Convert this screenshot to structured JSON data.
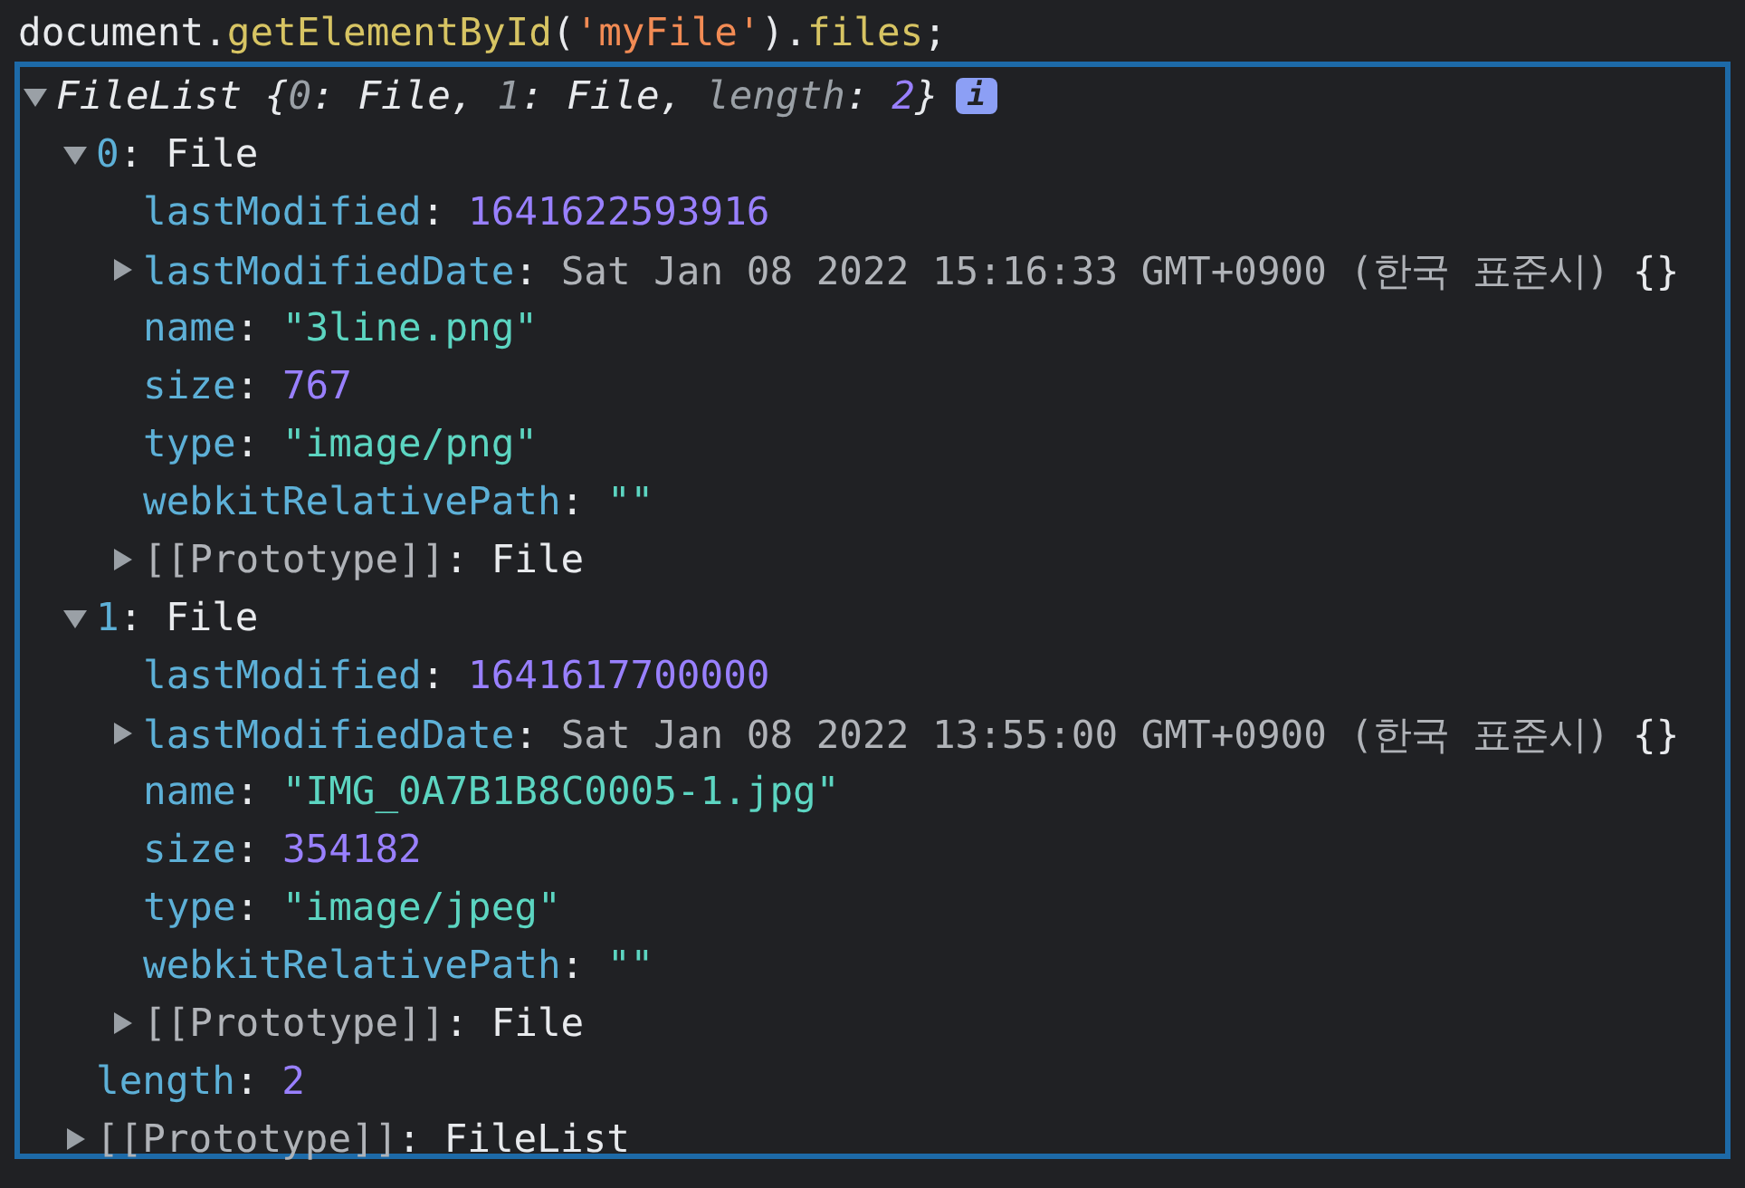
{
  "command": {
    "tokens": [
      {
        "kind": "plain",
        "text": "document."
      },
      {
        "kind": "method",
        "text": "getElementById"
      },
      {
        "kind": "plain",
        "text": "("
      },
      {
        "kind": "literal",
        "text": "'myFile'"
      },
      {
        "kind": "plain",
        "text": ")."
      },
      {
        "kind": "method",
        "text": "files"
      },
      {
        "kind": "plain",
        "text": ";"
      }
    ]
  },
  "result": {
    "expanded": true,
    "badge": "i",
    "tokens": [
      {
        "kind": "plain",
        "text": "FileList {"
      },
      {
        "kind": "dim",
        "text": "0"
      },
      {
        "kind": "plain",
        "text": ": File, "
      },
      {
        "kind": "dim",
        "text": "1"
      },
      {
        "kind": "plain",
        "text": ": File, "
      },
      {
        "kind": "dim",
        "text": "length"
      },
      {
        "kind": "plain",
        "text": ": "
      },
      {
        "kind": "number",
        "text": "2"
      },
      {
        "kind": "plain",
        "text": "}"
      }
    ],
    "children": [
      {
        "expanded": true,
        "tokens": [
          {
            "kind": "key",
            "text": "0"
          },
          {
            "kind": "plain",
            "text": ": File"
          }
        ],
        "children": [
          {
            "tokens": [
              {
                "kind": "key",
                "text": "lastModified"
              },
              {
                "kind": "plain",
                "text": ": "
              },
              {
                "kind": "number",
                "text": "1641622593916"
              }
            ]
          },
          {
            "expanded": false,
            "tokens": [
              {
                "kind": "key",
                "text": "lastModifiedDate"
              },
              {
                "kind": "plain",
                "text": ": "
              },
              {
                "kind": "grey",
                "text": "Sat Jan 08 2022 15:16:33 GMT+0900 (한국 표준시)"
              },
              {
                "kind": "plain",
                "text": " {}"
              }
            ]
          },
          {
            "tokens": [
              {
                "kind": "key",
                "text": "name"
              },
              {
                "kind": "plain",
                "text": ": "
              },
              {
                "kind": "string",
                "text": "\"3line.png\""
              }
            ]
          },
          {
            "tokens": [
              {
                "kind": "key",
                "text": "size"
              },
              {
                "kind": "plain",
                "text": ": "
              },
              {
                "kind": "number",
                "text": "767"
              }
            ]
          },
          {
            "tokens": [
              {
                "kind": "key",
                "text": "type"
              },
              {
                "kind": "plain",
                "text": ": "
              },
              {
                "kind": "string",
                "text": "\"image/png\""
              }
            ]
          },
          {
            "tokens": [
              {
                "kind": "key",
                "text": "webkitRelativePath"
              },
              {
                "kind": "plain",
                "text": ": "
              },
              {
                "kind": "string",
                "text": "\"\""
              }
            ]
          },
          {
            "expanded": false,
            "tokens": [
              {
                "kind": "grey",
                "text": "[[Prototype]]"
              },
              {
                "kind": "plain",
                "text": ": File"
              }
            ]
          }
        ]
      },
      {
        "expanded": true,
        "tokens": [
          {
            "kind": "key",
            "text": "1"
          },
          {
            "kind": "plain",
            "text": ": File"
          }
        ],
        "children": [
          {
            "tokens": [
              {
                "kind": "key",
                "text": "lastModified"
              },
              {
                "kind": "plain",
                "text": ": "
              },
              {
                "kind": "number",
                "text": "1641617700000"
              }
            ]
          },
          {
            "expanded": false,
            "tokens": [
              {
                "kind": "key",
                "text": "lastModifiedDate"
              },
              {
                "kind": "plain",
                "text": ": "
              },
              {
                "kind": "grey",
                "text": "Sat Jan 08 2022 13:55:00 GMT+0900 (한국 표준시)"
              },
              {
                "kind": "plain",
                "text": " {}"
              }
            ]
          },
          {
            "tokens": [
              {
                "kind": "key",
                "text": "name"
              },
              {
                "kind": "plain",
                "text": ": "
              },
              {
                "kind": "string",
                "text": "\"IMG_0A7B1B8C0005-1.jpg\""
              }
            ]
          },
          {
            "tokens": [
              {
                "kind": "key",
                "text": "size"
              },
              {
                "kind": "plain",
                "text": ": "
              },
              {
                "kind": "number",
                "text": "354182"
              }
            ]
          },
          {
            "tokens": [
              {
                "kind": "key",
                "text": "type"
              },
              {
                "kind": "plain",
                "text": ": "
              },
              {
                "kind": "string",
                "text": "\"image/jpeg\""
              }
            ]
          },
          {
            "tokens": [
              {
                "kind": "key",
                "text": "webkitRelativePath"
              },
              {
                "kind": "plain",
                "text": ": "
              },
              {
                "kind": "string",
                "text": "\"\""
              }
            ]
          },
          {
            "expanded": false,
            "tokens": [
              {
                "kind": "grey",
                "text": "[[Prototype]]"
              },
              {
                "kind": "plain",
                "text": ": File"
              }
            ]
          }
        ]
      },
      {
        "tokens": [
          {
            "kind": "key",
            "text": "length"
          },
          {
            "kind": "plain",
            "text": ": "
          },
          {
            "kind": "number",
            "text": "2"
          }
        ]
      },
      {
        "expanded": false,
        "tokens": [
          {
            "kind": "grey",
            "text": "[[Prototype]]"
          },
          {
            "kind": "plain",
            "text": ": FileList"
          }
        ]
      }
    ]
  }
}
